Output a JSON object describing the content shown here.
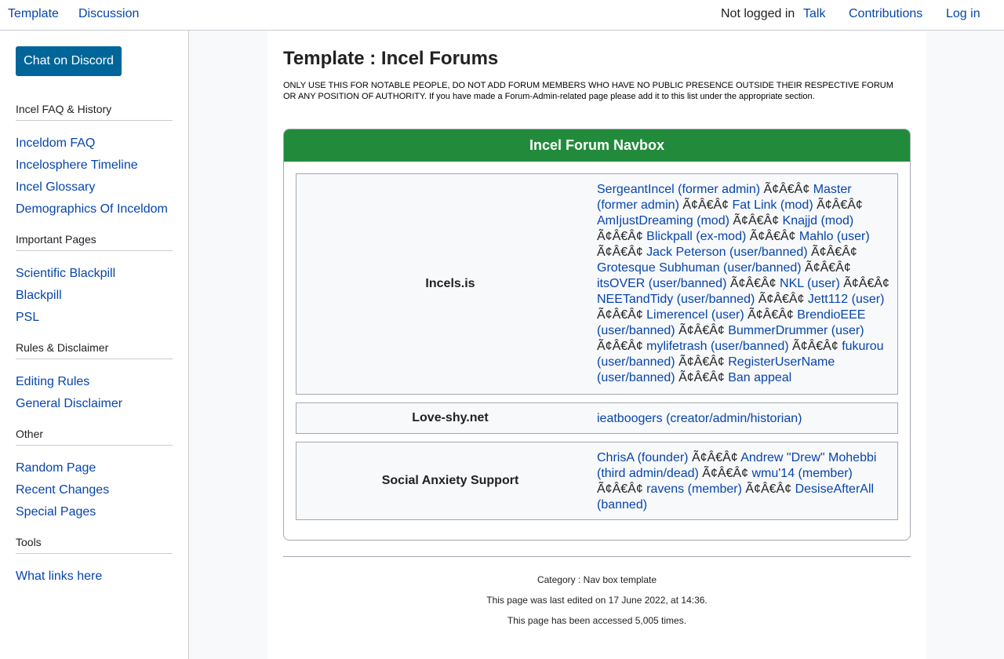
{
  "topbar": {
    "template_tab": "Template",
    "discussion_tab": "Discussion",
    "not_logged_in": "Not logged in",
    "talk": "Talk",
    "contributions": "Contributions",
    "login": "Log in"
  },
  "sidebar": {
    "discord_button": "Chat on Discord",
    "sections": [
      {
        "heading": "Incel FAQ & History",
        "links": [
          "Inceldom FAQ",
          "Incelosphere Timeline",
          "Incel Glossary",
          "Demographics Of Inceldom"
        ]
      },
      {
        "heading": "Important Pages",
        "links": [
          "Scientific Blackpill",
          "Blackpill",
          "PSL"
        ]
      },
      {
        "heading": "Rules & Disclaimer",
        "links": [
          "Editing Rules",
          "General Disclaimer"
        ]
      },
      {
        "heading": "Other",
        "links": [
          "Random Page",
          "Recent Changes",
          "Special Pages"
        ]
      },
      {
        "heading": "Tools",
        "links": [
          "What links here"
        ]
      }
    ]
  },
  "page": {
    "title": "Template : Incel Forums",
    "notice": "ONLY USE THIS FOR NOTABLE PEOPLE, DO NOT ADD FORUM MEMBERS WHO HAVE NO PUBLIC PRESENCE OUTSIDE THEIR RESPECTIVE FORUM OR ANY POSITION OF AUTHORITY. If you have made a Forum-Admin-related page please add it to this list under the appropriate section."
  },
  "navbox": {
    "title": "Incel Forum Navbox",
    "separator": " Ã¢Â€Â¢ ",
    "groups": [
      {
        "name": "Incels.is",
        "items": [
          "SergeantIncel (former admin)",
          "Master (former admin)",
          "Fat Link (mod)",
          "AmIjustDreaming (mod)",
          "Knajjd (mod)",
          "Blickpall (ex-mod)",
          "Mahlo (user)",
          "Jack Peterson (user/banned)",
          "Grotesque Subhuman (user/banned)",
          "itsOVER (user/banned)",
          "NKL (user)",
          "NEETandTidy (user/banned)",
          "Jett112 (user)",
          "Limerencel (user)",
          "BrendioEEE (user/banned)",
          "BummerDrummer (user)",
          "mylifetrash (user/banned)",
          "fukurou (user/banned)",
          "RegisterUserName (user/banned)",
          "Ban appeal"
        ]
      },
      {
        "name": "Love-shy.net",
        "items": [
          "ieatboogers (creator/admin/historian)"
        ]
      },
      {
        "name": "Social Anxiety Support",
        "items": [
          "ChrisA (founder)",
          "Andrew \"Drew\" Mohebbi (third admin/dead)",
          "wmu'14 (member)",
          "ravens (member)",
          "DesiseAfterAll (banned)"
        ]
      }
    ]
  },
  "footer": {
    "category": "Category : Nav box template",
    "last_edited": "This page was last edited on 17 June 2022, at 14:36.",
    "accessed": "This page has been accessed 5,005 times."
  },
  "colors": {
    "link": "#0645ad",
    "navbox_header": "#228b3b",
    "discord_button": "#006699"
  }
}
